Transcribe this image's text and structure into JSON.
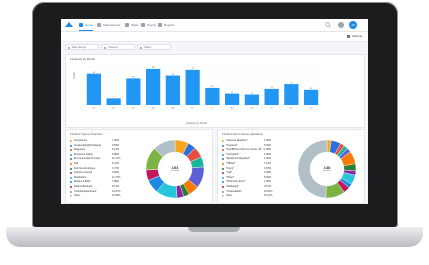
{
  "nav": {
    "items": [
      {
        "label": "Home",
        "active": true
      },
      {
        "label": "Submissions",
        "active": false
      },
      {
        "label": "Tasks",
        "active": false
      },
      {
        "label": "Teams",
        "active": false
      },
      {
        "label": "Reports",
        "active": false
      }
    ],
    "avatar_initials": "JS"
  },
  "subbar": {
    "admin_label": "Admins"
  },
  "filters": [
    {
      "label": "Date Range"
    },
    {
      "label": "Category"
    },
    {
      "label": "Status"
    }
  ],
  "bar_card": {
    "title": "Incidents by Month",
    "ylabel": "Count",
    "xlabel": "Incidents by Month"
  },
  "chart_data": [
    {
      "type": "bar",
      "title": "Incidents by Month",
      "categories": [
        "Jan",
        "Feb",
        "Mar",
        "Apr",
        "May",
        "Jun",
        "Jul",
        "Aug",
        "Sep",
        "Oct",
        "Nov",
        "Dec"
      ],
      "values": [
        33,
        7,
        28,
        38,
        31,
        37,
        18,
        12,
        11,
        17,
        22,
        16
      ],
      "ylim": [
        0,
        40
      ],
      "ylabel": "Count",
      "xlabel": "Incidents by Month",
      "data_labels": true
    },
    {
      "type": "pie",
      "title": "Incident Types Overview",
      "center_value": "153",
      "center_label": "Incidents",
      "labels": [
        "Compliance",
        "Credentialing/Privileging",
        "Diagnosis",
        "Employee Safety",
        "Environmental Services",
        "Fall",
        "Fall Non-Employee",
        "Infection Control",
        "Medication",
        "Mother & Baby",
        "Patient Behavior",
        "Unanticipated Event",
        "Other"
      ],
      "values": [
        7.84,
        4.58,
        6.13,
        5.88,
        12.17,
        6.19,
        3.37,
        3.84,
        12.17,
        7.88,
        6.13,
        13.27,
        12.8
      ],
      "colors": [
        "#f5a623",
        "#2a6fdb",
        "#e94e3c",
        "#16b79b",
        "#5c5fd6",
        "#f57c00",
        "#2e7d32",
        "#8e24aa",
        "#26c6da",
        "#1e88e5",
        "#c2185b",
        "#7cb342",
        "#b0bec5"
      ]
    },
    {
      "type": "pie",
      "title": "Incident Root Cause (detailed)",
      "center_value": "148",
      "center_label": "Incidents",
      "labels": [
        "*Adverse Reaction*",
        "*Assisted*",
        "*CLABSI/Central Line Assoc. Bl...*",
        "*Complaint*",
        "*Equipment/Supplies*",
        "*HIPAA*",
        "*Injury*",
        "*Lab*",
        "*Other*",
        "*Pharmacy Error*",
        "*Radiology*",
        "*Unavoidable*",
        "Other"
      ],
      "values": [
        2.38,
        5.36,
        2.38,
        2.38,
        2.38,
        7.14,
        3.97,
        2.38,
        5.36,
        2.38,
        3.57,
        10.81,
        49.21
      ],
      "colors": [
        "#f5a623",
        "#2a6fdb",
        "#e94e3c",
        "#16b79b",
        "#5c5fd6",
        "#f57c00",
        "#2e7d32",
        "#8e24aa",
        "#26c6da",
        "#1e88e5",
        "#c2185b",
        "#7cb342",
        "#b0bec5"
      ]
    }
  ],
  "donut1": {
    "title": "Incident Types Overview",
    "center_value": "153",
    "center_label": "Incidents",
    "rows": [
      {
        "label": "Compliance",
        "pct": "7.84%",
        "color": "#f5a623"
      },
      {
        "label": "Credentialing/Privileging",
        "pct": "4.58%",
        "color": "#2a6fdb"
      },
      {
        "label": "Diagnosis",
        "pct": "6.13%",
        "color": "#e94e3c"
      },
      {
        "label": "Employee Safety",
        "pct": "5.88%",
        "color": "#16b79b"
      },
      {
        "label": "Environmental Services",
        "pct": "12.17%",
        "color": "#5c5fd6"
      },
      {
        "label": "Fall",
        "pct": "6.19%",
        "color": "#f57c00"
      },
      {
        "label": "Fall Non-Employee",
        "pct": "3.37%",
        "color": "#2e7d32"
      },
      {
        "label": "Infection Control",
        "pct": "3.84%",
        "color": "#8e24aa"
      },
      {
        "label": "Medication",
        "pct": "12.17%",
        "color": "#26c6da"
      },
      {
        "label": "Mother & Baby",
        "pct": "7.88%",
        "color": "#1e88e5"
      },
      {
        "label": "Patient Behavior",
        "pct": "6.13%",
        "color": "#c2185b"
      },
      {
        "label": "Unanticipated Event",
        "pct": "13.27%",
        "color": "#7cb342"
      },
      {
        "label": "Other",
        "pct": "12.80%",
        "color": "#b0bec5"
      }
    ]
  },
  "donut2": {
    "title": "Incident Root Cause (detailed)",
    "center_value": "148",
    "center_label": "Incidents",
    "rows": [
      {
        "label": "*Adverse Reaction*",
        "pct": "2.38%",
        "color": "#f5a623"
      },
      {
        "label": "*Assisted*",
        "pct": "5.36%",
        "color": "#2a6fdb"
      },
      {
        "label": "*CLABSI/Central Line Assoc. Bl...*",
        "pct": "2.38%",
        "color": "#e94e3c"
      },
      {
        "label": "*Complaint*",
        "pct": "2.38%",
        "color": "#16b79b"
      },
      {
        "label": "*Equipment/Supplies*",
        "pct": "2.38%",
        "color": "#5c5fd6"
      },
      {
        "label": "*HIPAA*",
        "pct": "7.14%",
        "color": "#f57c00"
      },
      {
        "label": "*Injury*",
        "pct": "3.97%",
        "color": "#2e7d32"
      },
      {
        "label": "*Lab*",
        "pct": "2.38%",
        "color": "#8e24aa"
      },
      {
        "label": "*Other*",
        "pct": "5.36%",
        "color": "#26c6da"
      },
      {
        "label": "*Pharmacy Error*",
        "pct": "2.38%",
        "color": "#1e88e5"
      },
      {
        "label": "*Radiology*",
        "pct": "3.57%",
        "color": "#c2185b"
      },
      {
        "label": "*Unavoidable*",
        "pct": "10.81%",
        "color": "#7cb342"
      },
      {
        "label": "Other",
        "pct": "49.21%",
        "color": "#b0bec5"
      }
    ]
  },
  "colors": {
    "accent": "#1e88e5",
    "bar": "#2196f3",
    "bezel": "#1c1c1e",
    "screen_bg": "#f4f6f9"
  }
}
